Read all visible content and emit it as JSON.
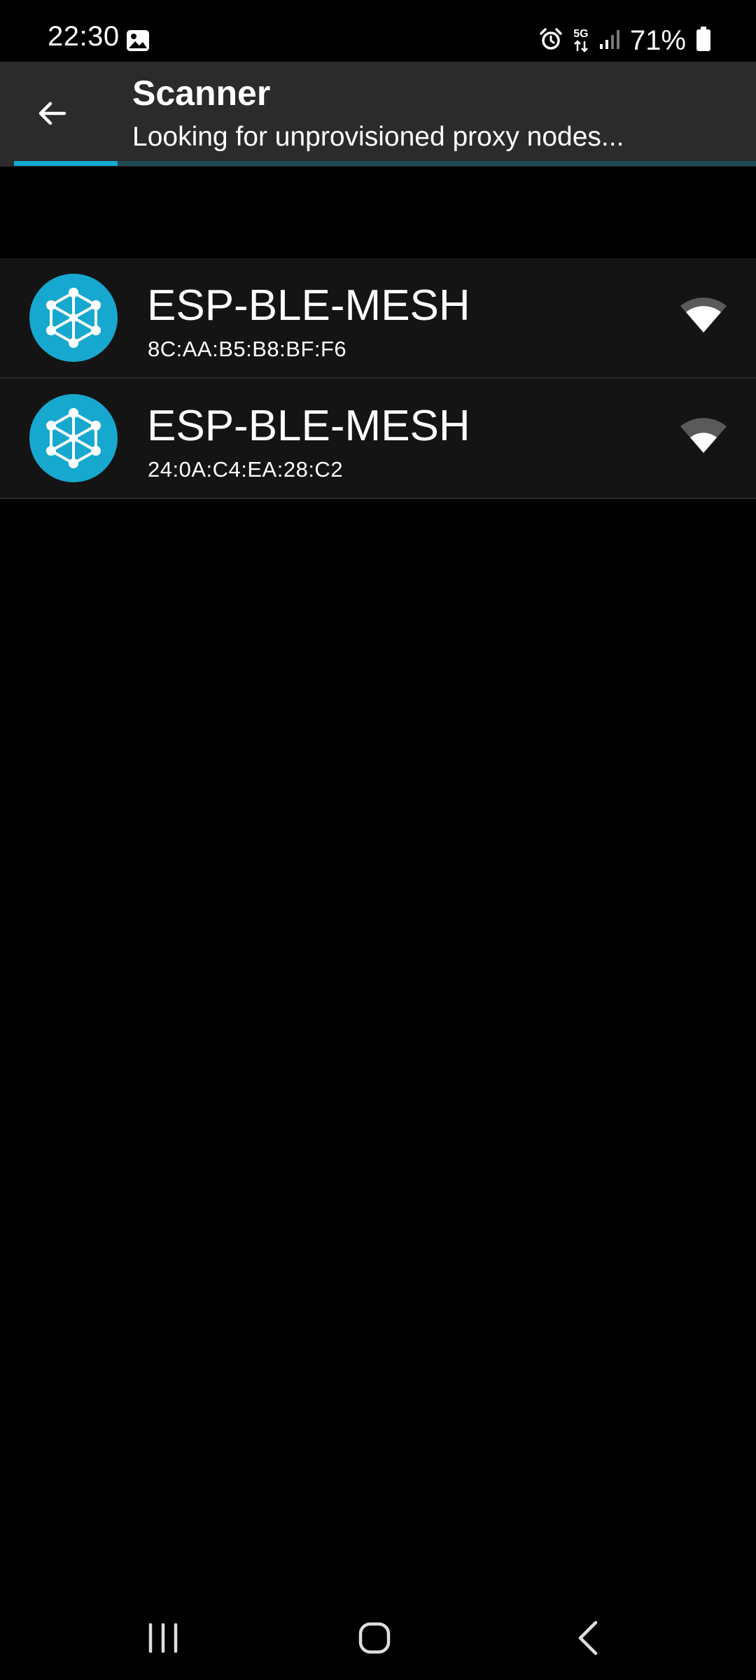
{
  "status_bar": {
    "time": "22:30",
    "battery_percent": "71%",
    "network_label": "5G",
    "icons": [
      "gallery-icon",
      "alarm-icon",
      "network-5g-icon",
      "signal-icon",
      "battery-icon"
    ]
  },
  "app_bar": {
    "title": "Scanner",
    "subtitle": "Looking for unprovisioned proxy nodes...",
    "back_icon": "arrow-left-icon",
    "scan_progress": 0.14
  },
  "devices": [
    {
      "name": "ESP-BLE-MESH",
      "address": "8C:AA:B5:B8:BF:F6",
      "icon": "mesh-node-icon",
      "signal_icon": "signal-strength-icon"
    },
    {
      "name": "ESP-BLE-MESH",
      "address": "24:0A:C4:EA:28:C2",
      "icon": "mesh-node-icon",
      "signal_icon": "signal-strength-icon"
    }
  ],
  "nav_bar": {
    "buttons": [
      "recents-icon",
      "home-icon",
      "back-icon"
    ]
  },
  "colors": {
    "accent": "#12a9d2",
    "app_bar_bg": "#2b2b2b",
    "list_row_bg": "#141414",
    "background": "#000000"
  }
}
